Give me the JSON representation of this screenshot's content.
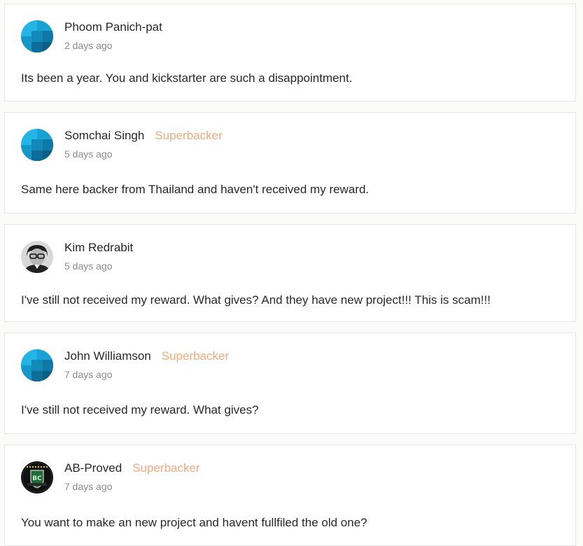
{
  "colors": {
    "superbacker_badge": "#f3a97b",
    "default_avatar": "#1aa1d4",
    "card_border": "#e6e6e6"
  },
  "comments": [
    {
      "author": "Phoom Panich-pat",
      "badge": "",
      "time": "2 days ago",
      "text": "Its been a year. You and kickstarter are such a disappointment.",
      "avatar": "default-avatar-icon"
    },
    {
      "author": "Somchai Singh",
      "badge": "Superbacker",
      "time": "5 days ago",
      "text": "Same here backer from Thailand and haven't received my reward.",
      "avatar": "default-avatar-icon"
    },
    {
      "author": "Kim Redrabit",
      "badge": "",
      "time": "5 days ago",
      "text": "I've still not received my reward. What gives? And they have new project!!! This is scam!!!",
      "avatar": "profile-photo-avatar"
    },
    {
      "author": "John Williamson",
      "badge": "Superbacker",
      "time": "7 days ago",
      "text": "I've still not received my reward. What gives?",
      "avatar": "default-avatar-icon"
    },
    {
      "author": "AB-Proved",
      "badge": "Superbacker",
      "time": "7 days ago",
      "text": "You want to make an new project and havent fullfiled the old one?",
      "avatar": "shield-logo-avatar"
    }
  ]
}
